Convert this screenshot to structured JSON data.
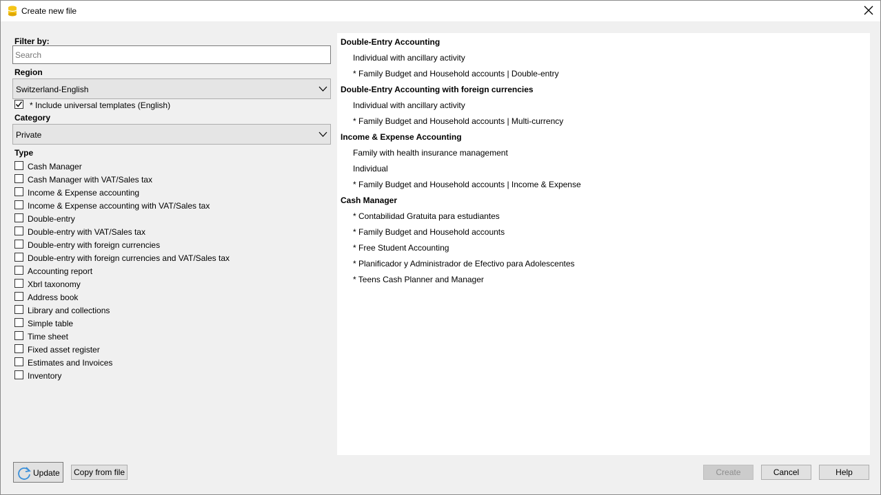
{
  "window": {
    "title": "Create new file"
  },
  "filter": {
    "label": "Filter by:",
    "search_placeholder": "Search",
    "search_value": ""
  },
  "region": {
    "label": "Region",
    "selected": "Switzerland-English",
    "include_universal_label": "* Include universal templates (English)",
    "include_universal_checked": true
  },
  "category": {
    "label": "Category",
    "selected": "Private"
  },
  "type": {
    "label": "Type",
    "options": [
      "Cash Manager",
      "Cash Manager with VAT/Sales tax",
      "Income & Expense accounting",
      "Income & Expense accounting with VAT/Sales tax",
      "Double-entry",
      "Double-entry with VAT/Sales tax",
      "Double-entry with foreign currencies",
      "Double-entry with foreign currencies and VAT/Sales tax",
      "Accounting report",
      "Xbrl taxonomy",
      "Address book",
      "Library and collections",
      "Simple table",
      "Time sheet",
      "Fixed asset register",
      "Estimates and Invoices",
      "Inventory"
    ]
  },
  "results": [
    {
      "group": "Double-Entry Accounting",
      "items": [
        "Individual with ancillary activity",
        "* Family Budget and Household accounts | Double-entry"
      ]
    },
    {
      "group": "Double-Entry Accounting with foreign currencies",
      "items": [
        "Individual with ancillary activity",
        "* Family Budget and Household accounts | Multi-currency"
      ]
    },
    {
      "group": "Income & Expense Accounting",
      "items": [
        "Family with health insurance management",
        "Individual",
        "* Family Budget and Household accounts | Income & Expense"
      ]
    },
    {
      "group": "Cash Manager",
      "items": [
        "* Contabilidad Gratuita para estudiantes",
        "* Family Budget and Household accounts",
        "* Free Student Accounting",
        "* Planificador y Administrador de Efectivo para Adolescentes",
        "* Teens Cash Planner and Manager"
      ]
    }
  ],
  "buttons": {
    "update": "Update",
    "copy_from_file": "Copy from file",
    "create": "Create",
    "cancel": "Cancel",
    "help": "Help"
  },
  "colors": {
    "app_icon": "#f5c518",
    "update_icon": "#3a8fd9"
  }
}
